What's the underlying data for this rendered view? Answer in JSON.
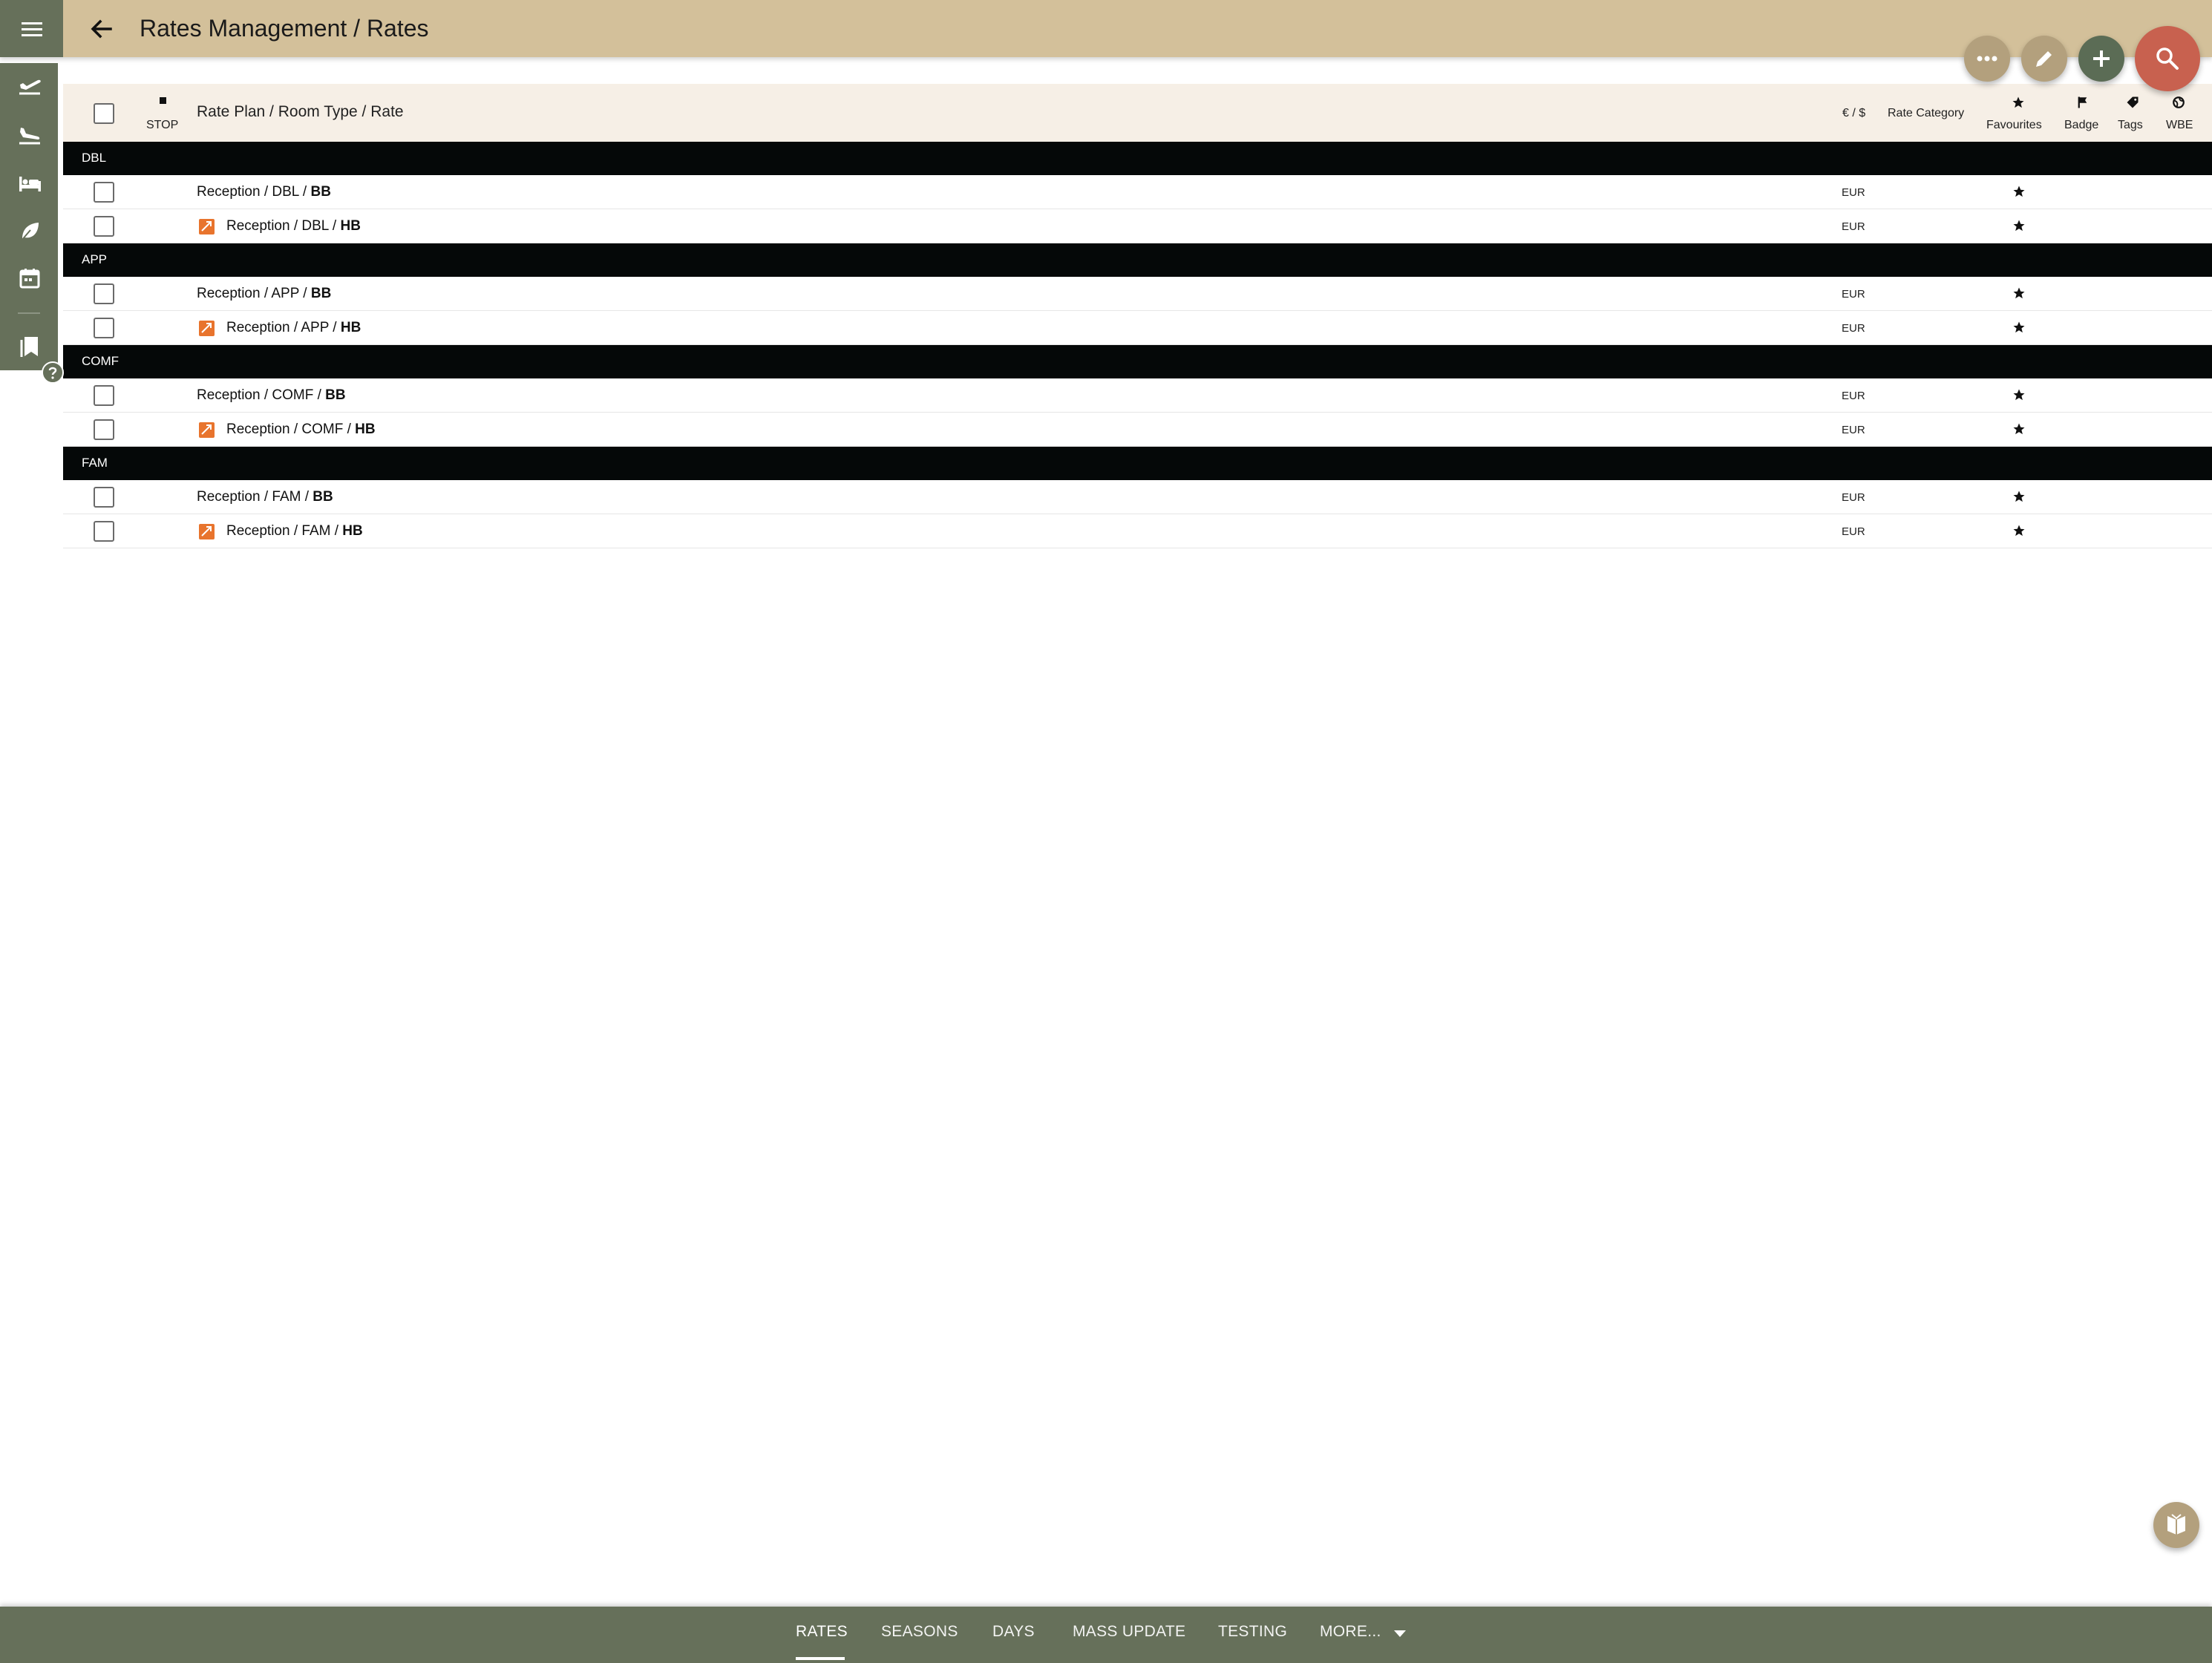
{
  "header": {
    "title": "Rates Management / Rates"
  },
  "table": {
    "columns": {
      "stop": "STOP",
      "rate_plan": "Rate Plan / Room Type / Rate",
      "currency": "€ / $",
      "rate_category": "Rate Category",
      "favourites": "Favourites",
      "badge": "Badge",
      "tags": "Tags",
      "wbe": "WBE"
    },
    "groups": [
      {
        "label": "DBL",
        "rows": [
          {
            "prefix": "Reception / DBL / ",
            "rate": "BB",
            "currency": "EUR",
            "derived": false
          },
          {
            "prefix": "Reception / DBL / ",
            "rate": "HB",
            "currency": "EUR",
            "derived": true
          }
        ]
      },
      {
        "label": "APP",
        "rows": [
          {
            "prefix": "Reception / APP / ",
            "rate": "BB",
            "currency": "EUR",
            "derived": false
          },
          {
            "prefix": "Reception / APP / ",
            "rate": "HB",
            "currency": "EUR",
            "derived": true
          }
        ]
      },
      {
        "label": "COMF",
        "rows": [
          {
            "prefix": "Reception / COMF / ",
            "rate": "BB",
            "currency": "EUR",
            "derived": false
          },
          {
            "prefix": "Reception / COMF / ",
            "rate": "HB",
            "currency": "EUR",
            "derived": true
          }
        ]
      },
      {
        "label": "FAM",
        "rows": [
          {
            "prefix": "Reception / FAM / ",
            "rate": "BB",
            "currency": "EUR",
            "derived": false
          },
          {
            "prefix": "Reception / FAM / ",
            "rate": "HB",
            "currency": "EUR",
            "derived": true
          }
        ]
      }
    ]
  },
  "bottom_nav": {
    "tabs": [
      {
        "label": "RATES",
        "active": true
      },
      {
        "label": "SEASONS",
        "active": false
      },
      {
        "label": "DAYS",
        "active": false
      },
      {
        "label": "MASS UPDATE",
        "active": false
      },
      {
        "label": "TESTING",
        "active": false
      },
      {
        "label": "MORE...",
        "active": false
      }
    ]
  },
  "icons": {
    "menu": "hamburger-menu-icon",
    "back": "arrow-back-icon",
    "fab_more": "more-horizontal-icon",
    "fab_edit": "pencil-icon",
    "fab_add": "plus-icon",
    "fab_search": "search-icon",
    "sidebar": [
      "departure-icon",
      "arrival-icon",
      "bed-icon",
      "leaf-icon",
      "calendar-icon",
      "bookmark-icon"
    ],
    "help": "help-icon",
    "book": "open-book-icon"
  },
  "colors": {
    "header": "#d3c09a",
    "sidebar": "#66705a",
    "group_row": "#050808",
    "table_header": "#f6efe6",
    "derived_badge": "#e8742d",
    "fab_search": "#c8614f",
    "fab_add": "#5b6c55",
    "fab_secondary": "#b3a07d"
  }
}
